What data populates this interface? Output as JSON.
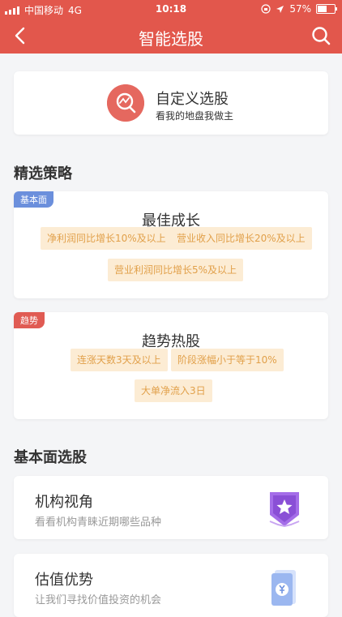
{
  "status": {
    "carrier": "中国移动",
    "network": "4G",
    "time": "10:18",
    "battery": "57%"
  },
  "nav": {
    "title": "智能选股"
  },
  "custom": {
    "title": "自定义选股",
    "subtitle": "看我的地盘我做主"
  },
  "sections": {
    "featured": "精选策略",
    "fundamental": "基本面选股"
  },
  "strategies": [
    {
      "tag": "基本面",
      "title": "最佳成长",
      "chips": [
        "净利润同比增长10%及以上",
        "营业收入同比增长20%及以上",
        "营业利润同比增长5%及以上"
      ]
    },
    {
      "tag": "趋势",
      "title": "趋势热股",
      "chips": [
        "连涨天数3天及以上",
        "阶段涨幅小于等于10%",
        "大单净流入3日"
      ]
    }
  ],
  "fundamentals": [
    {
      "title": "机构视角",
      "subtitle": "看看机构青睐近期哪些品种"
    },
    {
      "title": "估值优势",
      "subtitle": "让我们寻找价值投资的机会"
    }
  ],
  "colors": {
    "brand": "#e2574c",
    "tag_blue": "#6b8fdc",
    "tag_red": "#e05b53",
    "chip_bg": "#fcecd4",
    "chip_text": "#e1a04a"
  }
}
